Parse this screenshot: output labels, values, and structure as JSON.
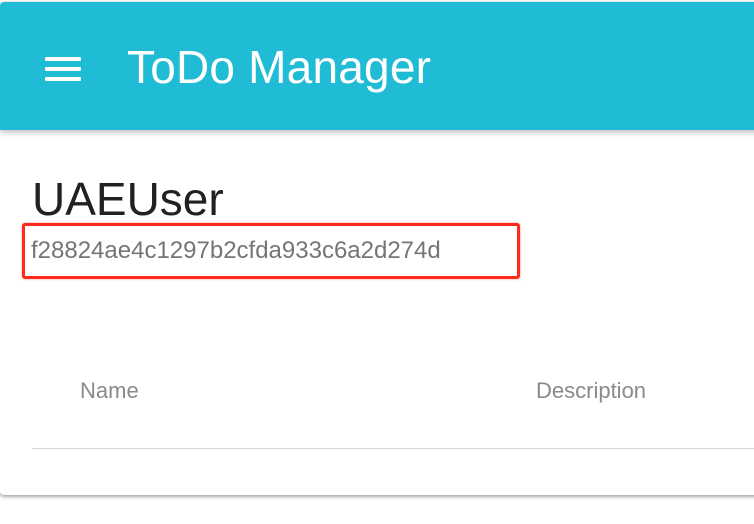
{
  "toolbar": {
    "title": "ToDo Manager",
    "menu_icon": "menu-icon",
    "color": "#20bcd5"
  },
  "user": {
    "name": "UAEUser",
    "id": "f28824ae4c1297b2cfda933c6a2d274d"
  },
  "highlight": {
    "color": "#ff2a1a"
  },
  "table": {
    "columns": [
      "Name",
      "Description"
    ]
  }
}
